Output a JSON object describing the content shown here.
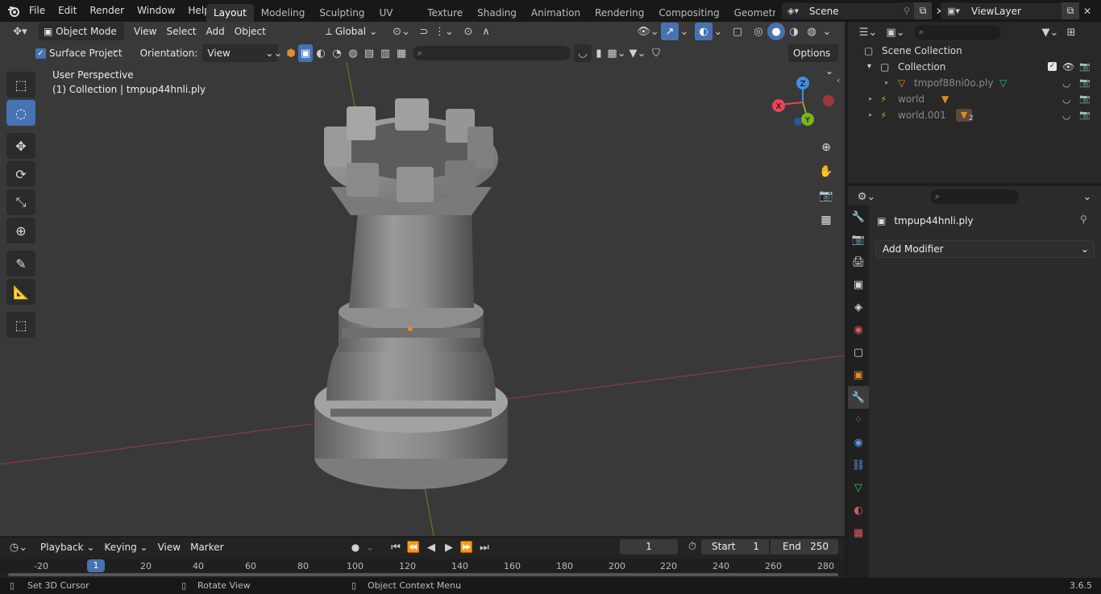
{
  "topbar": {
    "menus": [
      "File",
      "Edit",
      "Render",
      "Window",
      "Help"
    ],
    "workspaces": [
      "Layout",
      "Modeling",
      "Sculpting",
      "UV Editing",
      "Texture Paint",
      "Shading",
      "Animation",
      "Rendering",
      "Compositing",
      "Geometry Noc"
    ],
    "active_workspace": "Layout",
    "scene_name": "Scene",
    "view_layer": "ViewLayer"
  },
  "viewport": {
    "mode": "Object Mode",
    "menus": [
      "View",
      "Select",
      "Add",
      "Object"
    ],
    "transform_orientation": "Global",
    "surface_project_label": "Surface Project",
    "orientation_label": "Orientation:",
    "orientation_value": "View",
    "options_label": "Options",
    "overlay_title": "User Perspective",
    "overlay_subtitle": "(1) Collection | tmpup44hnli.ply",
    "gizmo": {
      "z": "Z",
      "y": "Y",
      "x": "X"
    }
  },
  "outliner": {
    "root": "Scene Collection",
    "collection": "Collection",
    "items": [
      {
        "name": "tmpof88ni0o.ply",
        "icon": "mesh-icon"
      },
      {
        "name": "world",
        "icon": "armature-icon"
      },
      {
        "name": "world.001",
        "icon": "armature-icon",
        "badge": "2"
      }
    ]
  },
  "properties": {
    "object_name": "tmpup44hnli.ply",
    "add_modifier": "Add Modifier"
  },
  "timeline": {
    "menus": [
      "Playback",
      "Keying",
      "View",
      "Marker"
    ],
    "current_frame": "1",
    "start_label": "Start",
    "start_value": "1",
    "end_label": "End",
    "end_value": "250",
    "ruler": [
      "-20",
      "1",
      "20",
      "40",
      "60",
      "80",
      "100",
      "120",
      "140",
      "160",
      "180",
      "200",
      "220",
      "240",
      "260",
      "280"
    ]
  },
  "statusbar": {
    "hint1": "Set 3D Cursor",
    "hint2": "Rotate View",
    "hint3": "Object Context Menu",
    "version": "3.6.5"
  },
  "colors": {
    "accent": "#4772b3",
    "x_axis": "#e94455",
    "y_axis": "#7db31f",
    "z_axis": "#3f8fe0",
    "orange": "#e28b2a"
  }
}
